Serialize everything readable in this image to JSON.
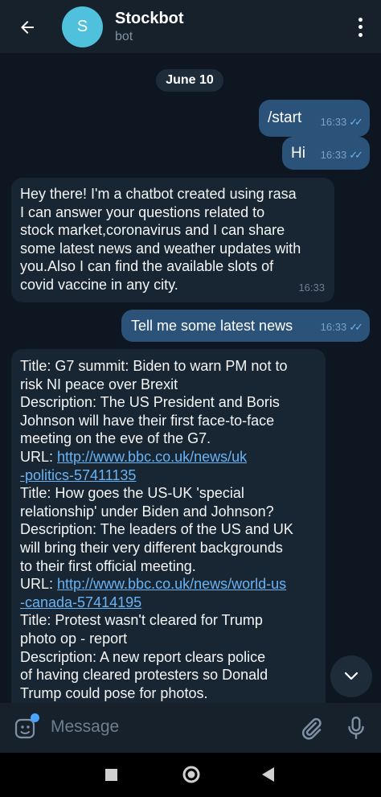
{
  "header": {
    "title": "Stockbot",
    "subtitle": "bot",
    "avatar_letter": "S"
  },
  "chat": {
    "date": "June 10",
    "messages": [
      {
        "dir": "out",
        "text": "/start",
        "time": "16:33"
      },
      {
        "dir": "out",
        "text": "Hi",
        "time": "16:33"
      },
      {
        "dir": "in",
        "lines": [
          "Hey there! I'm a chatbot created using rasa",
          "I can answer your questions related to",
          "stock market,coronavirus and I can share",
          "some latest news and weather updates with",
          "you.Also I can find the available slots of",
          "covid vaccine in any city."
        ],
        "time": "16:33"
      },
      {
        "dir": "out",
        "text": "Tell me some latest news",
        "time": "16:33"
      },
      {
        "dir": "in",
        "lines": [
          "Title: G7 summit: Biden to warn PM not to",
          "risk NI peace over Brexit",
          "Description: The US President and Boris",
          "Johnson will have their first face-to-face",
          "meeting on the eve of the G7.",
          "URL: ",
          "-politics-57411135",
          "Title: How goes the US-UK 'special",
          "relationship' under Biden and Johnson?",
          "Description: The leaders of the US and UK",
          "will bring their very different backgrounds",
          "to their first official meeting.",
          "URL: ",
          "-canada-57414195",
          "Title: Protest wasn't cleared for Trump",
          "photo op - report",
          "Description: A new report clears police",
          "of having cleared protesters so Donald",
          "Trump could pose for photos."
        ],
        "links": [
          "http://www.bbc.co.uk/news/uk",
          "http://www.bbc.co.uk/news/world-us"
        ]
      }
    ]
  },
  "input": {
    "placeholder": "Message"
  }
}
